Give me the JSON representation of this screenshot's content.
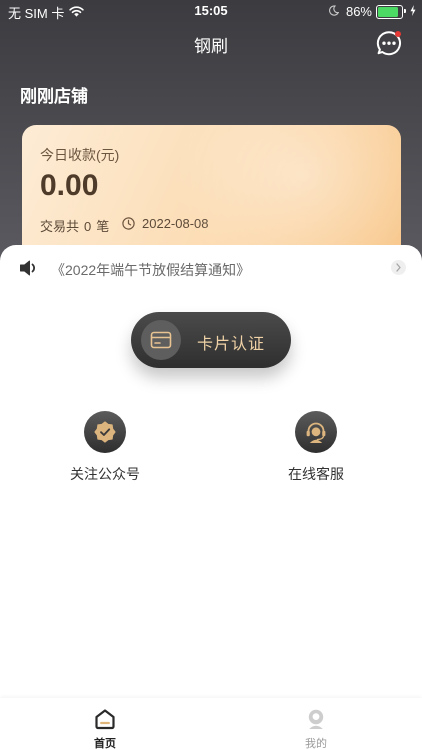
{
  "status_bar": {
    "carrier": "无 SIM 卡",
    "time": "15:05",
    "battery": "86%",
    "battery_charging": true
  },
  "header": {
    "title": "钢刷",
    "chat_icon": "chat-bubble-icon"
  },
  "store": {
    "name": "刚刚店铺"
  },
  "summary_card": {
    "label": "今日收款(元)",
    "amount": "0.00",
    "tx_prefix": "交易共",
    "tx_count": "0",
    "tx_suffix": "笔",
    "date": "2022-08-08"
  },
  "notice": {
    "text": "《2022年端午节放假结算通知》",
    "icon": "speaker-icon"
  },
  "card_auth": {
    "label": "卡片认证",
    "icon": "card-icon"
  },
  "actions": [
    {
      "label": "关注公众号",
      "icon": "verified-badge-icon"
    },
    {
      "label": "在线客服",
      "icon": "headset-icon"
    }
  ],
  "tab_bar": {
    "items": [
      {
        "label": "首页",
        "icon": "home-icon",
        "active": true
      },
      {
        "label": "我的",
        "icon": "user-icon",
        "active": false
      }
    ]
  },
  "colors": {
    "header_bg": "#3b3b40",
    "card_gradient_start": "#fdecd6",
    "card_gradient_end": "#f8c88d",
    "gold_accent": "#e7c492",
    "battery_green": "#4cd964",
    "notification_dot": "#e53935"
  }
}
